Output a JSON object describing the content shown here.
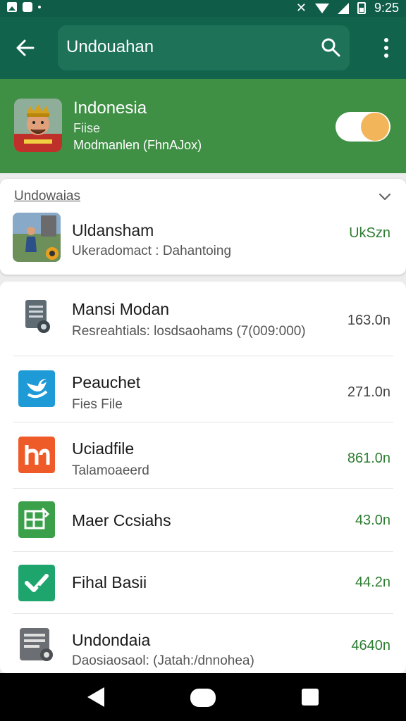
{
  "status_bar": {
    "time": "9:25"
  },
  "app_bar": {
    "search_text": "Undouahan"
  },
  "banner": {
    "title": "Indonesia",
    "subtitle": "Fiise",
    "detail": "Modmanlen (FhnAJox)",
    "toggle_on": true,
    "toggle_color": "#f2b55a"
  },
  "section": {
    "title": "Undowaias",
    "item": {
      "name": "Uldansham",
      "description": "Ukeradomact : Dahantoing",
      "size": "UkSzn"
    }
  },
  "files": [
    {
      "name": "Mansi Modan",
      "description": "Resreahtials: losdsaohams (7(009:000)",
      "size": "163.0n",
      "icon": "document-icon",
      "size_color": "#444444"
    },
    {
      "name": "Peauchet",
      "description": "Fies File",
      "size": "271.0n",
      "icon": "twitter-bird-icon",
      "size_color": "#444444"
    },
    {
      "name": "Uciadfile",
      "description": "Talamoaeerd",
      "size": "861.0n",
      "icon": "letter-h-icon",
      "size_color": "#2e7d32"
    },
    {
      "name": "Maer Ccsiahs",
      "description": "",
      "size": "43.0n",
      "icon": "spreadsheet-icon",
      "size_color": "#2e7d32"
    },
    {
      "name": "Fihal Basii",
      "description": "",
      "size": "44.2n",
      "icon": "checkmark-icon",
      "size_color": "#2e7d32"
    },
    {
      "name": "Undondaia",
      "description": "Daosiaosaol: (Jatah:/dnnohea)",
      "size": "4640n",
      "icon": "document-gear-icon",
      "size_color": "#2e7d32"
    }
  ],
  "colors": {
    "app_bar": "#11634c",
    "banner": "#3f8f45",
    "accent_green": "#2e7d32"
  }
}
